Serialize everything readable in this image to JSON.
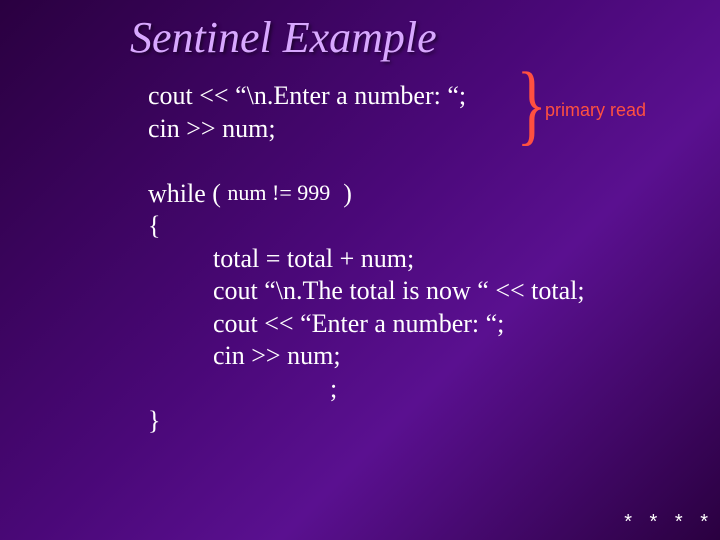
{
  "title": "Sentinel Example",
  "code": {
    "l1": "cout << “\\n.Enter a number: “;",
    "l2": "cin >> num;",
    "l3a": "while ( ",
    "l3cond": "num != 999",
    "l3b": "  )",
    "l4": "{",
    "l5": "          total = total + num;",
    "l6": "          cout “\\n.The total is now “ << total;",
    "l7": "          cout << “Enter a number: “;",
    "l8": "          cin >> num;",
    "l9": "                            ;",
    "l10": "}"
  },
  "annotation": {
    "brace": "}",
    "label": "primary read"
  },
  "footer": "* * * *"
}
